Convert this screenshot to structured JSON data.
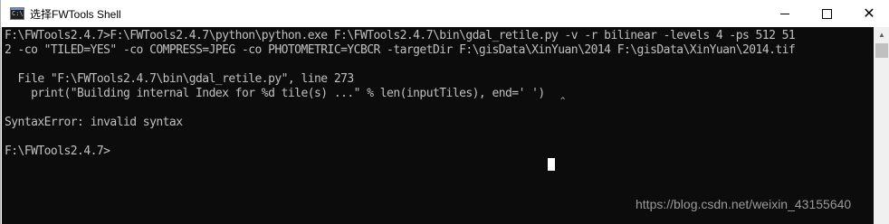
{
  "window": {
    "title": "选择FWTools Shell",
    "icon": "console-icon",
    "controls": {
      "minimize": "minimize-icon",
      "maximize": "maximize-icon",
      "close": "close-icon"
    }
  },
  "console": {
    "background": "#0c0c0c",
    "foreground": "#c0c0c0",
    "lines": [
      "F:\\FWTools2.4.7>F:\\FWTools2.4.7\\python\\python.exe F:\\FWTools2.4.7\\bin\\gdal_retile.py -v -r bilinear -levels 4 -ps 512 51",
      "2 -co \"TILED=YES\" -co COMPRESS=JPEG -co PHOTOMETRIC=YCBCR -targetDir F:\\gisData\\XinYuan\\2014 F:\\gisData\\XinYuan\\2014.tif",
      "",
      "  File \"F:\\FWTools2.4.7\\bin\\gdal_retile.py\", line 273",
      "    print(\"Building internal Index for %d tile(s) ...\" % len(inputTiles), end=' ')",
      "",
      "SyntaxError: invalid syntax",
      "",
      "F:\\FWTools2.4.7>"
    ],
    "error_caret": "^"
  },
  "watermark": "https://blog.csdn.net/weixin_43155640"
}
